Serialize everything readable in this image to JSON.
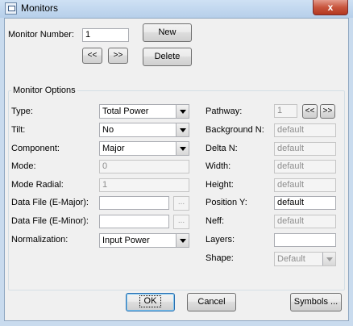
{
  "window": {
    "title": "Monitors",
    "close_glyph": "x"
  },
  "monitor": {
    "number_label": "Monitor Number:",
    "number_value": "1",
    "new_label": "New",
    "delete_label": "Delete",
    "prev_label": "<<",
    "next_label": ">>"
  },
  "options": {
    "group_title": "Monitor Options",
    "left": {
      "type_label": "Type:",
      "type_value": "Total Power",
      "tilt_label": "Tilt:",
      "tilt_value": "No",
      "component_label": "Component:",
      "component_value": "Major",
      "mode_label": "Mode:",
      "mode_value": "0",
      "mode_radial_label": "Mode Radial:",
      "mode_radial_value": "1",
      "data_major_label": "Data File (E-Major):",
      "data_major_value": "",
      "data_minor_label": "Data File (E-Minor):",
      "data_minor_value": "",
      "browse_label": "...",
      "normalization_label": "Normalization:",
      "normalization_value": "Input Power"
    },
    "right": {
      "pathway_label": "Pathway:",
      "pathway_value": "1",
      "pathway_prev": "<<",
      "pathway_next": ">>",
      "background_label": "Background N:",
      "background_value": "default",
      "delta_label": "Delta N:",
      "delta_value": "default",
      "width_label": "Width:",
      "width_value": "default",
      "height_label": "Height:",
      "height_value": "default",
      "posy_label": "Position Y:",
      "posy_value": "default",
      "neff_label": "Neff:",
      "neff_value": "default",
      "layers_label": "Layers:",
      "layers_value": "",
      "shape_label": "Shape:",
      "shape_value": "Default"
    }
  },
  "footer": {
    "ok_label": "OK",
    "cancel_label": "Cancel",
    "symbols_label": "Symbols ..."
  }
}
